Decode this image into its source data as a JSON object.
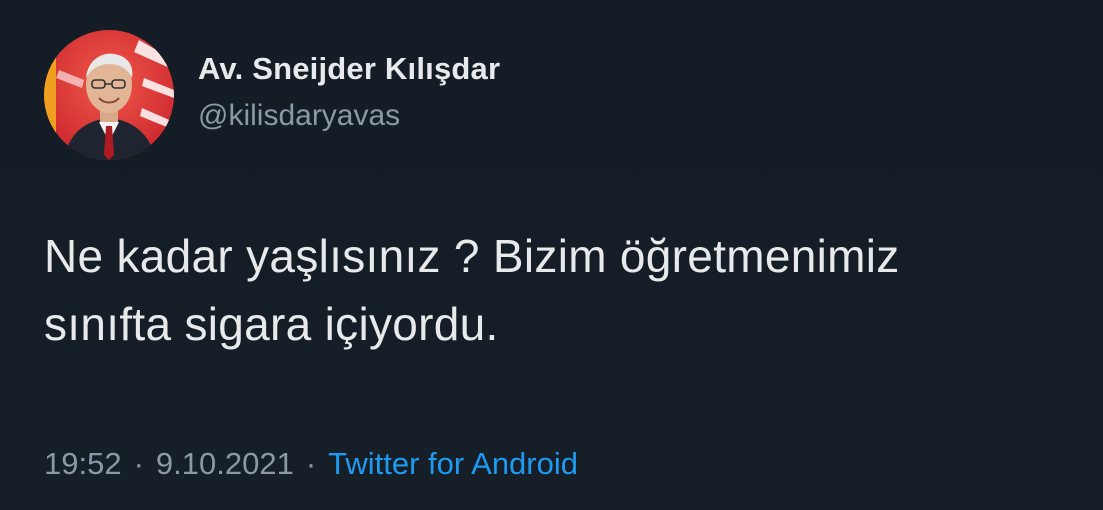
{
  "author": {
    "display_name": "Av. Sneijder Kılışdar",
    "handle": "@kilisdaryavas",
    "avatar_icon": "profile-avatar"
  },
  "tweet": {
    "text": "Ne kadar yaşlısınız ? Bizim öğretmenimiz\nsınıfta sigara içiyordu.",
    "time": "19:52",
    "separator_1": "·",
    "date": "9.10.2021",
    "separator_2": "·",
    "source": "Twitter for Android"
  },
  "colors": {
    "background": "#15202b",
    "primary_text": "#e7e9ea",
    "secondary_text": "#8b98a5",
    "link": "#1d9bf0"
  }
}
